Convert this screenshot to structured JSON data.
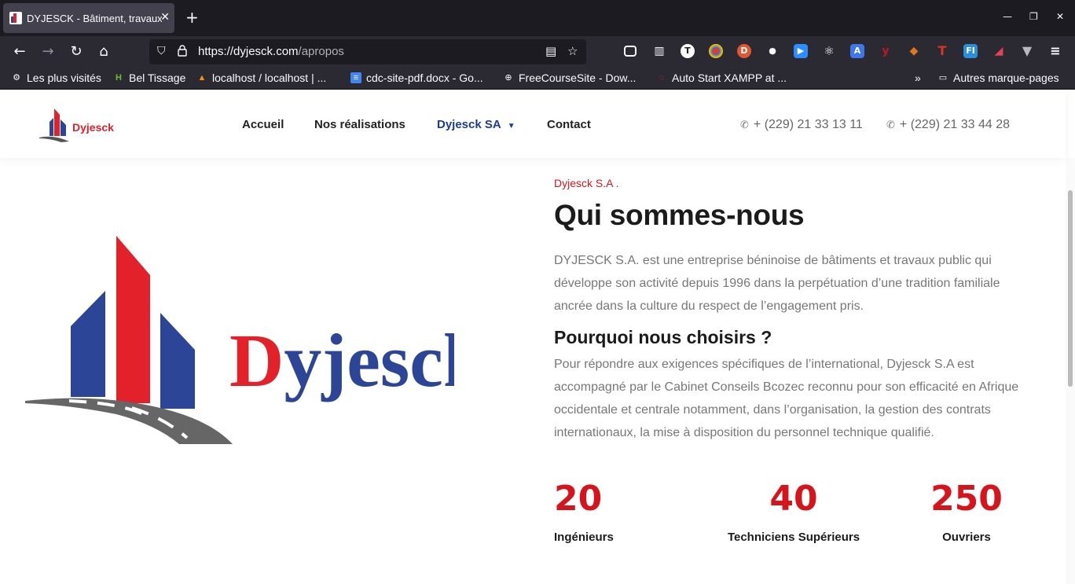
{
  "browser": {
    "tab_title": "DYJESCK - Bâtiment, travaux",
    "url_host": "https://dyjesck.com",
    "url_path": "/apropos",
    "bookmarks": [
      {
        "label": "Les plus visités",
        "icon": "gear-icon"
      },
      {
        "label": "Bel Tissage",
        "icon": "h-icon"
      },
      {
        "label": "localhost / localhost | ...",
        "icon": "phpmyadmin-icon"
      },
      {
        "label": "cdc-site-pdf.docx - Go...",
        "icon": "docs-icon"
      },
      {
        "label": "FreeCourseSite - Dow...",
        "icon": "globe-icon"
      },
      {
        "label": "Auto Start XAMPP at ...",
        "icon": "spinner-icon"
      }
    ],
    "other_bookmarks": "Autres marque-pages"
  },
  "site": {
    "brand": "Dyjesck",
    "menu": {
      "home": "Accueil",
      "works": "Nos réalisations",
      "company": "Dyjesck SA",
      "contact": "Contact"
    },
    "phones": [
      "+ (229) 21 33 13 11",
      "+ (229) 21 33 44 28"
    ]
  },
  "about": {
    "eyebrow": "Dyjesck S.A .",
    "title": "Qui sommes-nous",
    "intro": "DYJESCK S.A. est une entreprise béninoise de bâtiments et travaux public qui développe son activité depuis 1996 dans la perpétuation d’une tradition familiale ancrée dans la culture du respect de l’engagement pris.",
    "why_title": "Pourquoi nous choisirs ?",
    "why_text": "Pour répondre aux exigences spécifiques de l’international, Dyjesck S.A est accompagné par le Cabinet Conseils Bcozec reconnu pour son efficacité en Afrique occidentale et centrale notamment, dans l’organisation, la gestion des contrats internationaux, la mise à disposition du personnel technique qualifié."
  },
  "stats": [
    {
      "value": "20",
      "label": "Ingénieurs"
    },
    {
      "value": "40",
      "label": "Techniciens Supérieurs"
    },
    {
      "value": "250",
      "label": "Ouvriers"
    }
  ],
  "colors": {
    "brand_red": "#d7141c",
    "brand_blue": "#2d4597",
    "menu_active": "#1a3a9c"
  }
}
